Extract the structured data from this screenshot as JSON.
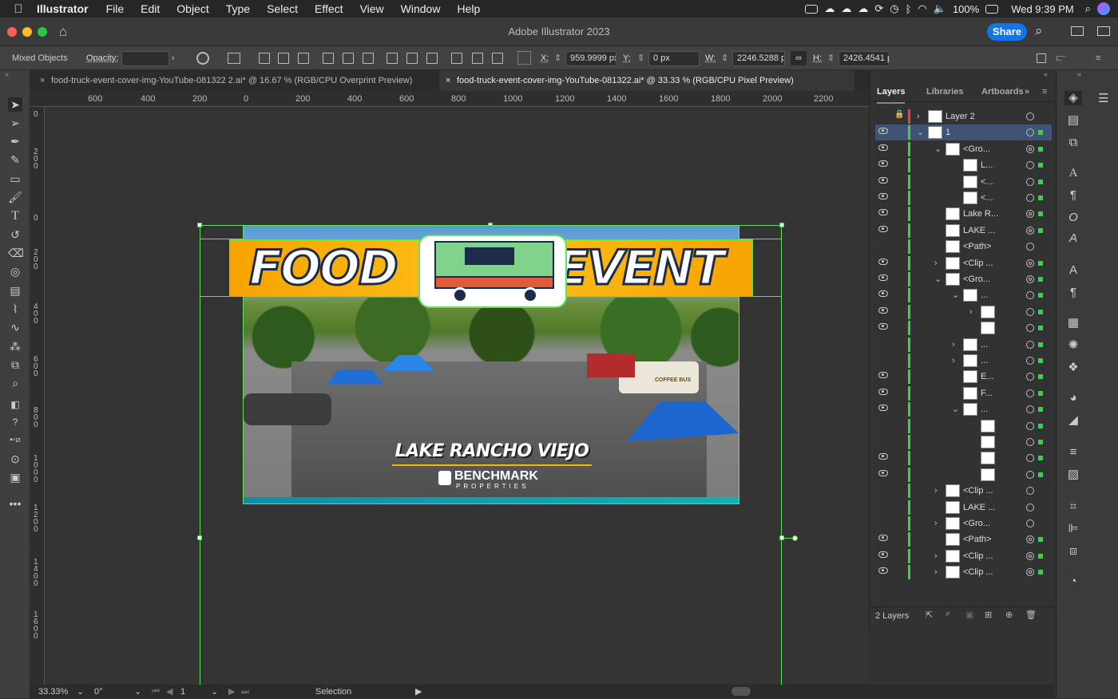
{
  "menubar": {
    "app_name": "Illustrator",
    "items": [
      "File",
      "Edit",
      "Object",
      "Type",
      "Select",
      "Effect",
      "View",
      "Window",
      "Help"
    ],
    "battery": "100%",
    "datetime": "Wed 9:39 PM"
  },
  "titlebar": {
    "title": "Adobe Illustrator 2023",
    "share_label": "Share"
  },
  "control": {
    "selection_type": "Mixed Objects",
    "opacity_label": "Opacity:",
    "x_label": "X:",
    "x_value": "959.9999 px",
    "y_label": "Y:",
    "y_value": "0 px",
    "w_label": "W:",
    "w_value": "2246.5288 px",
    "h_label": "H:",
    "h_value": "2426.4541 px"
  },
  "tabs": [
    {
      "label": "food-truck-event-cover-img-YouTube-081322 2.ai* @ 16.67 % (RGB/CPU Overprint Preview)",
      "close": "×"
    },
    {
      "label": "food-truck-event-cover-img-YouTube-081322.ai* @ 33.33 % (RGB/CPU Pixel Preview)",
      "close": "×"
    }
  ],
  "ruler": {
    "h_ticks": [
      "600",
      "400",
      "200",
      "0",
      "200",
      "400",
      "600",
      "800",
      "1000",
      "1200",
      "1400",
      "1600",
      "1800",
      "2000",
      "2200"
    ],
    "v_ticks": [
      "0",
      "200",
      "0",
      "200",
      "400",
      "600",
      "800",
      "1000",
      "1200",
      "1400",
      "1600"
    ]
  },
  "artwork": {
    "headline_left": "FOOD",
    "headline_right": "EVENT",
    "truck_sign": "COFFEE BUS",
    "location": "LAKE RANCHO VIEJO",
    "brand": "BENCHMARK",
    "brand_sub": "PROPERTIES"
  },
  "panel": {
    "tabs": [
      "Layers",
      "Libraries",
      "Artboards"
    ],
    "rows": [
      {
        "name": "Layer 2",
        "indent": 0,
        "eye": false,
        "tw": "›",
        "ring": false,
        "sq": false,
        "lock": true
      },
      {
        "name": "1",
        "indent": 0,
        "eye": true,
        "tw": "⌄",
        "ring": false,
        "sq": true,
        "sel": true
      },
      {
        "name": "<Gro...",
        "indent": 1,
        "eye": true,
        "tw": "⌄",
        "ring": true,
        "sq": true
      },
      {
        "name": "L...",
        "indent": 2,
        "eye": true,
        "tw": "",
        "ring": false,
        "sq": true
      },
      {
        "name": "<...",
        "indent": 2,
        "eye": true,
        "tw": "",
        "ring": false,
        "sq": true
      },
      {
        "name": "<...",
        "indent": 2,
        "eye": true,
        "tw": "",
        "ring": false,
        "sq": true
      },
      {
        "name": "Lake R...",
        "indent": 1,
        "eye": true,
        "tw": "",
        "ring": true,
        "sq": true
      },
      {
        "name": "LAKE ...",
        "indent": 1,
        "eye": true,
        "tw": "",
        "ring": true,
        "sq": true
      },
      {
        "name": "<Path>",
        "indent": 1,
        "eye": false,
        "tw": "",
        "ring": false,
        "sq": false
      },
      {
        "name": "<Clip ...",
        "indent": 1,
        "eye": true,
        "tw": "›",
        "ring": true,
        "sq": true
      },
      {
        "name": "<Gro...",
        "indent": 1,
        "eye": true,
        "tw": "⌄",
        "ring": true,
        "sq": true
      },
      {
        "name": "...",
        "indent": 2,
        "eye": true,
        "tw": "⌄",
        "ring": false,
        "sq": true
      },
      {
        "name": "",
        "indent": 3,
        "eye": true,
        "tw": "›",
        "ring": false,
        "sq": true
      },
      {
        "name": "",
        "indent": 3,
        "eye": true,
        "tw": "",
        "ring": false,
        "sq": true
      },
      {
        "name": "...",
        "indent": 2,
        "eye": false,
        "tw": "›",
        "ring": false,
        "sq": true
      },
      {
        "name": "...",
        "indent": 2,
        "eye": false,
        "tw": "›",
        "ring": false,
        "sq": true
      },
      {
        "name": "E...",
        "indent": 2,
        "eye": true,
        "tw": "",
        "ring": false,
        "sq": true
      },
      {
        "name": "F...",
        "indent": 2,
        "eye": true,
        "tw": "",
        "ring": false,
        "sq": true
      },
      {
        "name": "...",
        "indent": 2,
        "eye": true,
        "tw": "⌄",
        "ring": false,
        "sq": true
      },
      {
        "name": "",
        "indent": 3,
        "eye": false,
        "tw": "",
        "ring": false,
        "sq": true
      },
      {
        "name": "",
        "indent": 3,
        "eye": false,
        "tw": "",
        "ring": false,
        "sq": true
      },
      {
        "name": "",
        "indent": 3,
        "eye": true,
        "tw": "",
        "ring": false,
        "sq": true
      },
      {
        "name": "",
        "indent": 3,
        "eye": true,
        "tw": "",
        "ring": false,
        "sq": true
      },
      {
        "name": "<Clip ...",
        "indent": 1,
        "eye": false,
        "tw": "›",
        "ring": false,
        "sq": false
      },
      {
        "name": "LAKE ...",
        "indent": 1,
        "eye": false,
        "tw": "",
        "ring": false,
        "sq": false
      },
      {
        "name": "<Gro...",
        "indent": 1,
        "eye": false,
        "tw": "›",
        "ring": false,
        "sq": false
      },
      {
        "name": "<Path>",
        "indent": 1,
        "eye": true,
        "tw": "",
        "ring": true,
        "sq": true
      },
      {
        "name": "<Clip ...",
        "indent": 1,
        "eye": true,
        "tw": "›",
        "ring": true,
        "sq": true
      },
      {
        "name": "<Clip ...",
        "indent": 1,
        "eye": true,
        "tw": "›",
        "ring": true,
        "sq": true
      }
    ],
    "footer_count": "2 Layers"
  },
  "status": {
    "zoom": "33.33%",
    "rotation": "0°",
    "artboard": "1",
    "tool": "Selection"
  },
  "colors": {
    "accent": "#1473e6",
    "layer_color": "#3ecf4d",
    "selection_row": "#3f5374",
    "banner_yellow": "#f7b500"
  }
}
